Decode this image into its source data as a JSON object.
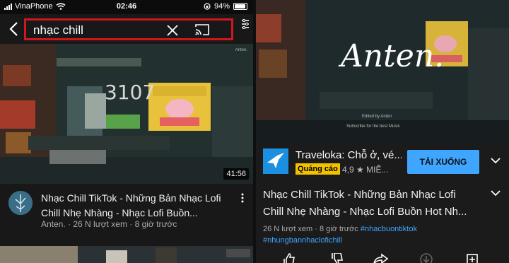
{
  "status": {
    "carrier": "VinaPhone",
    "time": "02:46",
    "battery": "94%",
    "battery_level": 0.94
  },
  "search": {
    "query": "nhạc chill",
    "highlight_color": "#d0161e"
  },
  "video_left": {
    "duration": "41:56",
    "watermark": "Anten.",
    "title": "Nhạc Chill TikTok - Những Bản Nhạc Lofi Chill Nhẹ Nhàng - Nhạc Lofi Buồn...",
    "meta": "Anten. · 26 N lượt xem · 8 giờ trước"
  },
  "player": {
    "overlay_title": "Anten.",
    "edited_text": "Edited by Anten.",
    "subscribe_text": "Subscribe for the best Music"
  },
  "ad": {
    "title": "Traveloka: Chỗ ở, vé...",
    "badge": "Quảng cáo",
    "rating": "4,9 ★ MIỄ...",
    "cta": "TẢI XUỐNG",
    "cta_color": "#3ea6ff"
  },
  "video_right": {
    "title": "Nhạc Chill TikTok - Những Bản Nhạc Lofi Chill Nhẹ Nhàng - Nhạc Lofi Buồn Hot Nh...",
    "meta": "26 N lượt xem · 8 giờ trước",
    "tag1": "#nhacbuontiktok",
    "tag2": "#nhungbannhaclofichill"
  },
  "icons": [
    "back-icon",
    "clear-icon",
    "cast-icon",
    "more-icon",
    "menu-dots-icon",
    "chevron-down-icon",
    "like-icon",
    "dislike-icon",
    "share-icon",
    "download-icon",
    "save-icon"
  ]
}
